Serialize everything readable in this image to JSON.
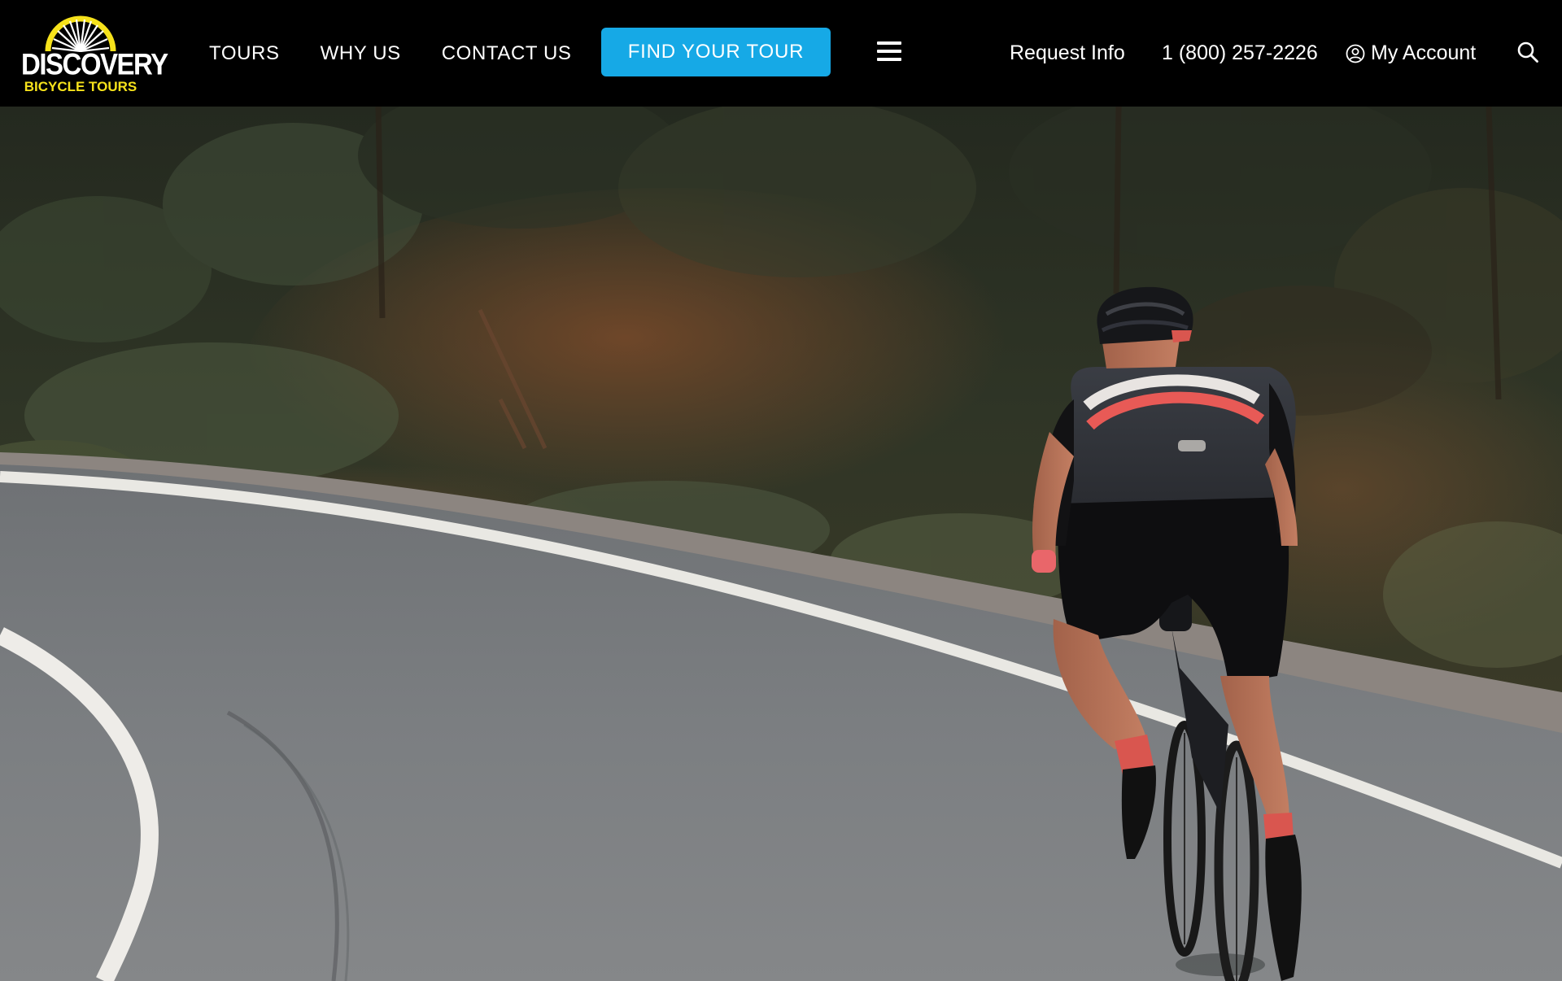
{
  "brand": {
    "name": "DISCOVERY",
    "tagline": "BICYCLE TOURS",
    "logo_icon": "bicycle-wheel-icon",
    "primary_color": "#000000",
    "accent_color": "#f6e21b"
  },
  "nav": {
    "items": [
      {
        "label": "TOURS"
      },
      {
        "label": "WHY US"
      },
      {
        "label": "CONTACT US"
      }
    ],
    "cta_label": "FIND YOUR TOUR",
    "cta_color": "#16a9e6",
    "menu_icon": "hamburger-menu-icon"
  },
  "utility": {
    "request_info": "Request Info",
    "phone": "1 (800) 257-2226",
    "account": "My Account",
    "account_icon": "user-circle-icon",
    "search_icon": "search-icon"
  },
  "hero": {
    "image": "cyclist-on-curving-mountain-road"
  }
}
